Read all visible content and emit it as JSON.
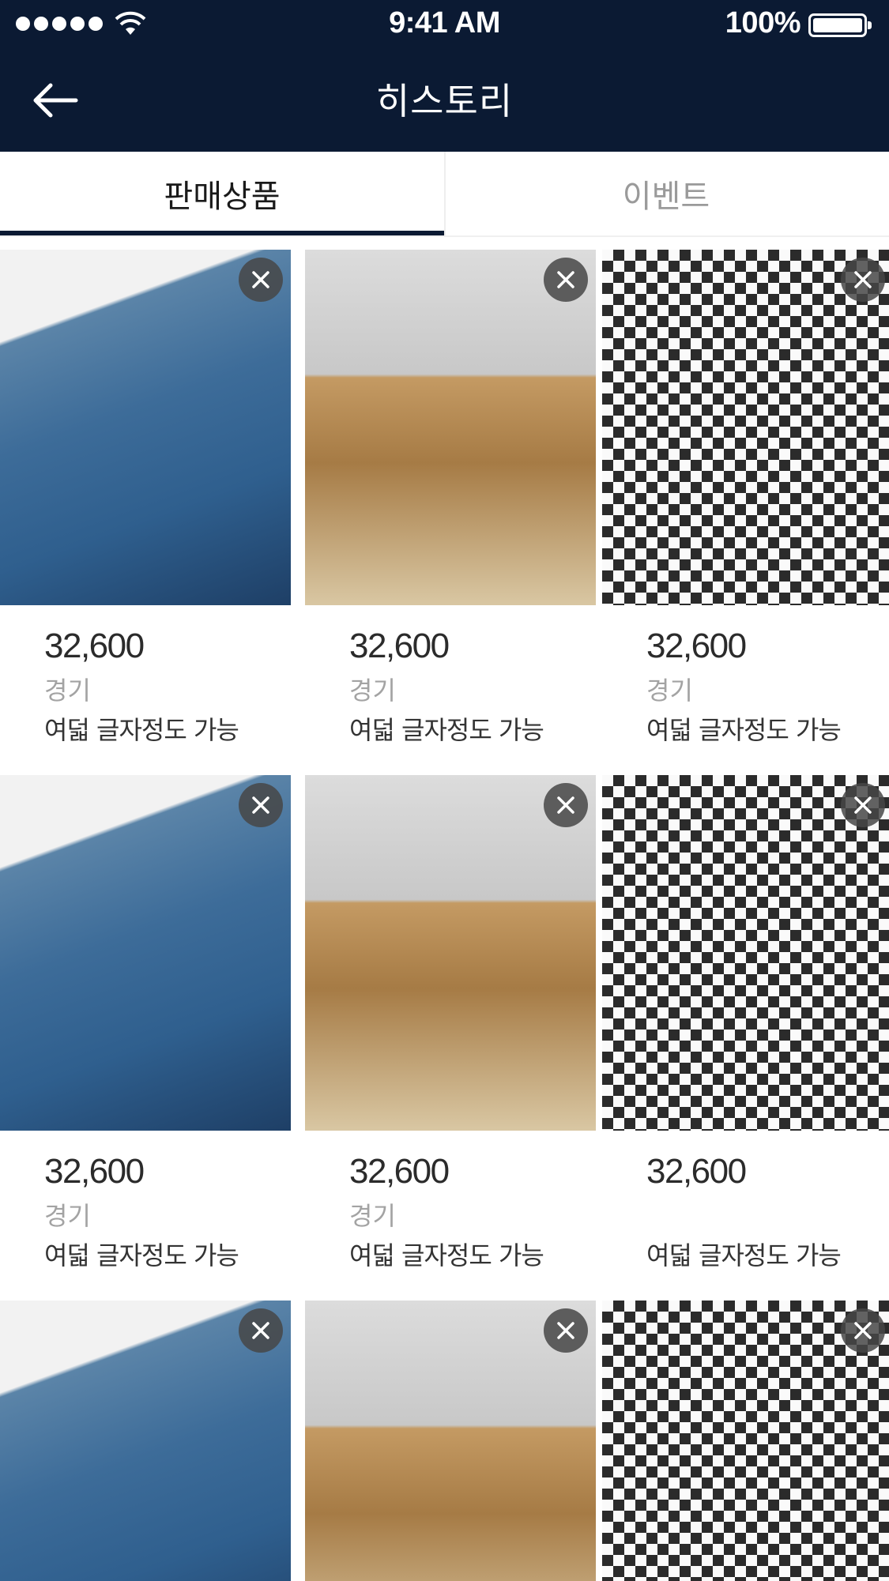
{
  "status_bar": {
    "time": "9:41 AM",
    "battery": "100%"
  },
  "header": {
    "title": "히스토리",
    "back_icon": "arrow-left-icon"
  },
  "tabs": [
    {
      "label": "판매상품",
      "active": true
    },
    {
      "label": "이벤트",
      "active": false
    }
  ],
  "products": [
    {
      "image": "jeans",
      "price": "32,600",
      "region": "경기",
      "desc": "여덟 글자정도 가능"
    },
    {
      "image": "shirt",
      "price": "32,600",
      "region": "경기",
      "desc": "여덟 글자정도 가능"
    },
    {
      "image": "check",
      "price": "32,600",
      "region": "경기",
      "desc": "여덟 글자정도 가능"
    },
    {
      "image": "jeans",
      "price": "32,600",
      "region": "경기",
      "desc": "여덟 글자정도 가능"
    },
    {
      "image": "shirt",
      "price": "32,600",
      "region": "경기",
      "desc": "여덟 글자정도 가능"
    },
    {
      "image": "check",
      "price": "32,600",
      "region": "",
      "desc": "여덟 글자정도 가능"
    },
    {
      "image": "jeans",
      "price": "",
      "region": "",
      "desc": ""
    },
    {
      "image": "shirt",
      "price": "",
      "region": "",
      "desc": ""
    },
    {
      "image": "check",
      "price": "",
      "region": "",
      "desc": ""
    }
  ],
  "colors": {
    "header_bg": "#0b1a33",
    "tab_indicator": "#0b1a33",
    "remove_bg": "#464646"
  }
}
